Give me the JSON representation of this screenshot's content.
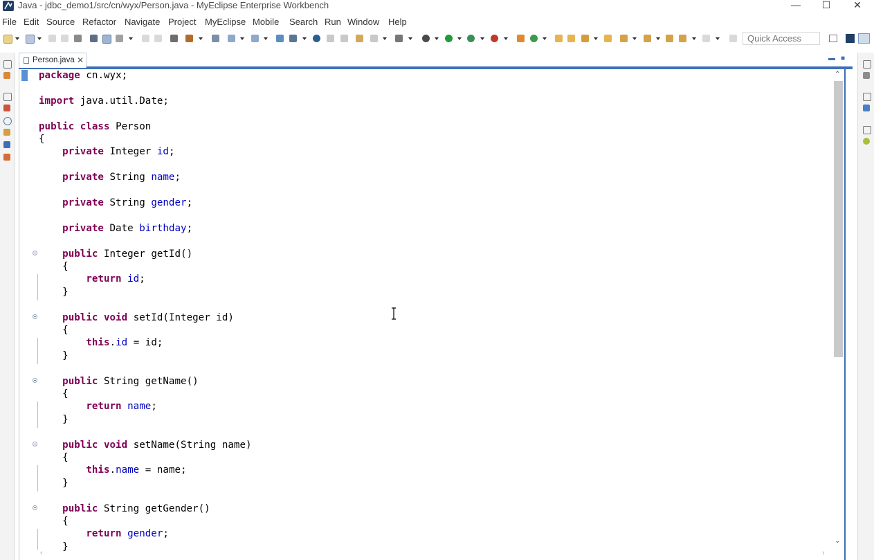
{
  "window": {
    "title": "Java - jdbc_demo1/src/cn/wyx/Person.java - MyEclipse Enterprise Workbench",
    "minimize": "—",
    "maximize": "☐",
    "close": "✕"
  },
  "menu": [
    "File",
    "Edit",
    "Source",
    "Refactor",
    "Navigate",
    "Project",
    "MyEclipse",
    "Mobile",
    "Search",
    "Run",
    "Window",
    "Help"
  ],
  "toolbar": {
    "quick_access_placeholder": "Quick Access",
    "icons": [
      "new-icon",
      "save-icon",
      "print-icon",
      "search-icon",
      "debug-icon",
      "run-icon",
      "external-tools-icon",
      "back-icon",
      "forward-icon"
    ]
  },
  "editor": {
    "tab_label": "Person.java",
    "tab_close": "✕",
    "maximize": "▬",
    "restore": "■",
    "code_lines": [
      "package cn.wyx;",
      "",
      "import java.util.Date;",
      "",
      "public class Person",
      "{",
      "    private Integer id;",
      "",
      "    private String name;",
      "",
      "    private String gender;",
      "",
      "    private Date birthday;",
      "",
      "    public Integer getId()",
      "    {",
      "        return id;",
      "    }",
      "",
      "    public void setId(Integer id)",
      "    {",
      "        this.id = id;",
      "    }",
      "",
      "    public String getName()",
      "    {",
      "        return name;",
      "    }",
      "",
      "    public void setName(String name)",
      "    {",
      "        this.name = name;",
      "    }",
      "",
      "    public String getGender()",
      "    {",
      "        return gender;",
      "    }"
    ]
  },
  "scroll": {
    "up": "⌃",
    "down": "⌄",
    "left": "‹",
    "right": "›"
  },
  "colors": {
    "keyword": "#7f0055",
    "field": "#0000c0",
    "accent": "#3d6fb6"
  }
}
